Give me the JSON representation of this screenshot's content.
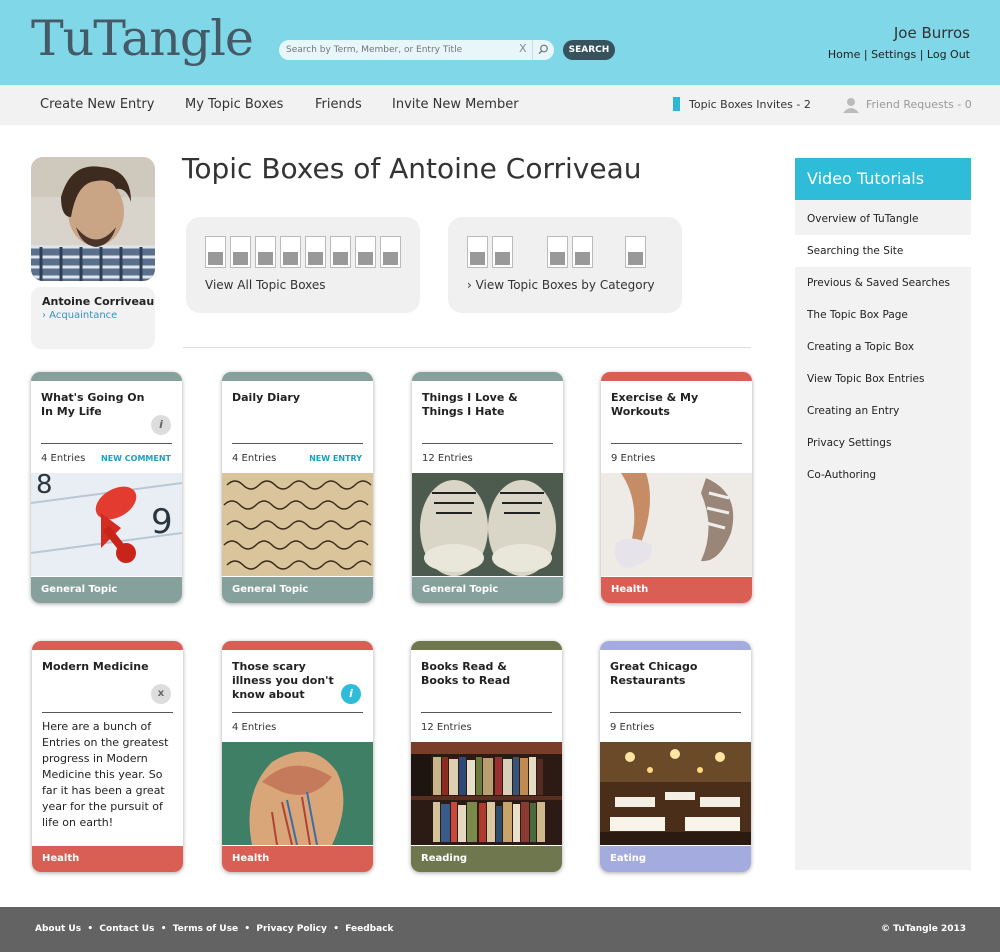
{
  "header": {
    "logo": "TuTangle",
    "search_placeholder": "Search by Term, Member, or Entry Title",
    "search_button": "SEARCH",
    "user_name": "Joe Burros",
    "links": [
      "Home",
      "Settings",
      "Log Out"
    ],
    "bg_color": "#7fd7e8"
  },
  "nav": {
    "items": [
      "Create New Entry",
      "My Topic Boxes",
      "Friends",
      "Invite New Member"
    ],
    "invites": "Topic Boxes Invites - 2",
    "friend_requests": "Friend Requests - 0"
  },
  "profile": {
    "name": "Antoine Corriveau",
    "relation": "› Acquaintance",
    "page_title": "Topic Boxes of Antoine Corriveau",
    "view_all": "View All Topic Boxes",
    "view_by_category": "› View Topic Boxes by Category"
  },
  "cards": [
    {
      "title": "What's Going On In My Life",
      "entries": "4 Entries",
      "action": "NEW COMMENT",
      "category": "General Topic",
      "color": "#86a19b",
      "badge": "i",
      "image": "pushpin"
    },
    {
      "title": "Daily Diary",
      "entries": "4 Entries",
      "action": "NEW ENTRY",
      "category": "General Topic",
      "color": "#86a19b",
      "image": "handwriting"
    },
    {
      "title": "Things I Love & Things I Hate",
      "entries": "12 Entries",
      "category": "General Topic",
      "color": "#86a19b",
      "image": "sneakers"
    },
    {
      "title": "Exercise & My Workouts",
      "entries": "9 Entries",
      "category": "Health",
      "color": "#d95f55",
      "image": "running"
    },
    {
      "title": "Modern Medicine",
      "description": "Here are a bunch of Entries on the greatest progress in Modern Medicine this year. So far it has been a great year for the pursuit of life on earth!",
      "category": "Health",
      "color": "#d95f55",
      "badge": "x"
    },
    {
      "title": "Those scary illness you don't know about",
      "entries": "4 Entries",
      "category": "Health",
      "color": "#d95f55",
      "badge": "i",
      "image": "anatomy"
    },
    {
      "title": "Books Read & Books to Read",
      "entries": "12 Entries",
      "category": "Reading",
      "color": "#6f774e",
      "image": "bookshelf"
    },
    {
      "title": "Great Chicago Restaurants",
      "entries": "9 Entries",
      "category": "Eating",
      "color": "#a4acdf",
      "image": "restaurant"
    }
  ],
  "sidebar": {
    "title": "Video Tutorials",
    "items": [
      "Overview of TuTangle",
      "Searching the Site",
      "Previous & Saved Searches",
      "The Topic Box Page",
      "Creating a Topic Box",
      "View Topic Box Entries",
      "Creating an Entry",
      "Privacy Settings",
      "Co-Authoring"
    ]
  },
  "footer": {
    "links": [
      "About Us",
      "Contact Us",
      "Terms of Use",
      "Privacy Policy",
      "Feedback"
    ],
    "copyright": "© TuTangle 2013"
  }
}
